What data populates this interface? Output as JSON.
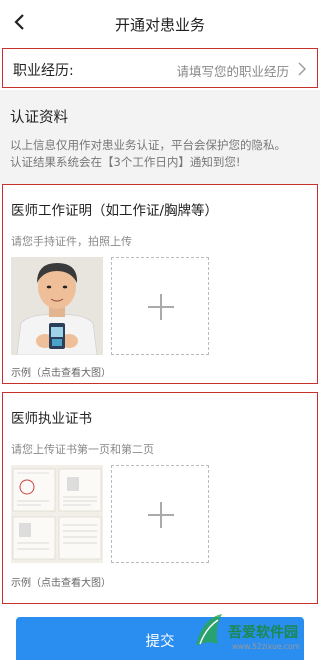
{
  "nav": {
    "back_icon": "chevron-left-icon",
    "title": "开通对患业务"
  },
  "career": {
    "label": "职业经历:",
    "placeholder": "请填写您的职业经历",
    "icon": "chevron-right-icon"
  },
  "certification": {
    "title": "认证资料",
    "desc_line1": "以上信息仅用作对患业务认证，平台会保护您的隐私。",
    "desc_line2": "认证结果系统会在【3个工作日内】通知到您!"
  },
  "work_proof": {
    "title": "医师工作证明（如工作证/胸牌等）",
    "hint": "请您手持证件，拍照上传",
    "sample_caption": "示例（点击查看大图）"
  },
  "license": {
    "title": "医师执业证书",
    "hint": "请您上传证书第一页和第二页",
    "sample_caption": "示例（点击查看大图）"
  },
  "submit_label": "提交",
  "watermark": {
    "name": "吾爱软件园",
    "url": "www.52zixue.com"
  },
  "colors": {
    "highlight_border": "#c9302c",
    "submit_bg": "#2a8df0",
    "section_bg": "#f3f3f3"
  }
}
